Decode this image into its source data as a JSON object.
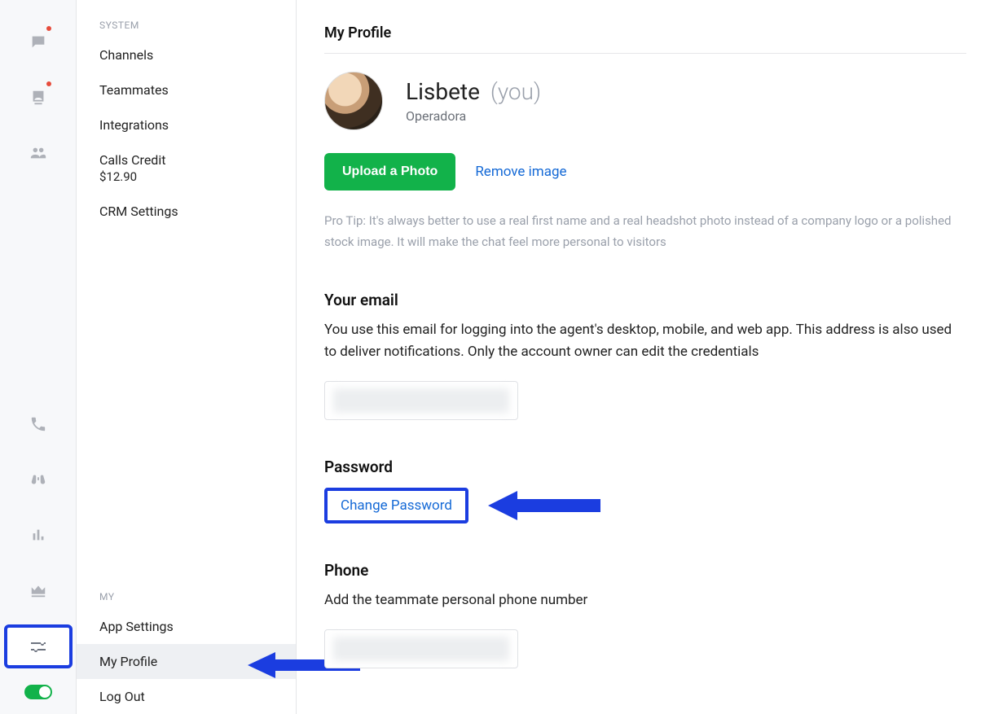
{
  "iconbar": {
    "chat": "chat",
    "contact": "contact",
    "team": "team",
    "phone": "phone",
    "visitors": "visitors",
    "stats": "stats",
    "crown": "crown",
    "settings": "settings"
  },
  "sidebar": {
    "group_system": "SYSTEM",
    "system_items": {
      "channels": "Channels",
      "teammates": "Teammates",
      "integrations": "Integrations",
      "calls_credit": "Calls Credit",
      "calls_credit_value": "$12.90",
      "crm_settings": "CRM Settings"
    },
    "group_my": "MY",
    "my_items": {
      "app_settings": "App Settings",
      "my_profile": "My Profile",
      "log_out": "Log Out"
    }
  },
  "page": {
    "title": "My Profile",
    "name": "Lisbete",
    "you_suffix": "(you)",
    "role": "Operadora",
    "upload_btn": "Upload a Photo",
    "remove_link": "Remove image",
    "pro_tip": "Pro Tip: It's always better to use a real first name and a real headshot photo instead of a company logo or a polished stock image. It will make the chat feel more personal to visitors",
    "email_h": "Your email",
    "email_desc": "You use this email for logging into the agent's desktop, mobile, and web app. This address is also used to deliver notifications. Only the account owner can edit the credentials",
    "password_h": "Password",
    "change_pw": "Change Password",
    "phone_h": "Phone",
    "phone_desc": "Add the teammate personal phone number"
  }
}
